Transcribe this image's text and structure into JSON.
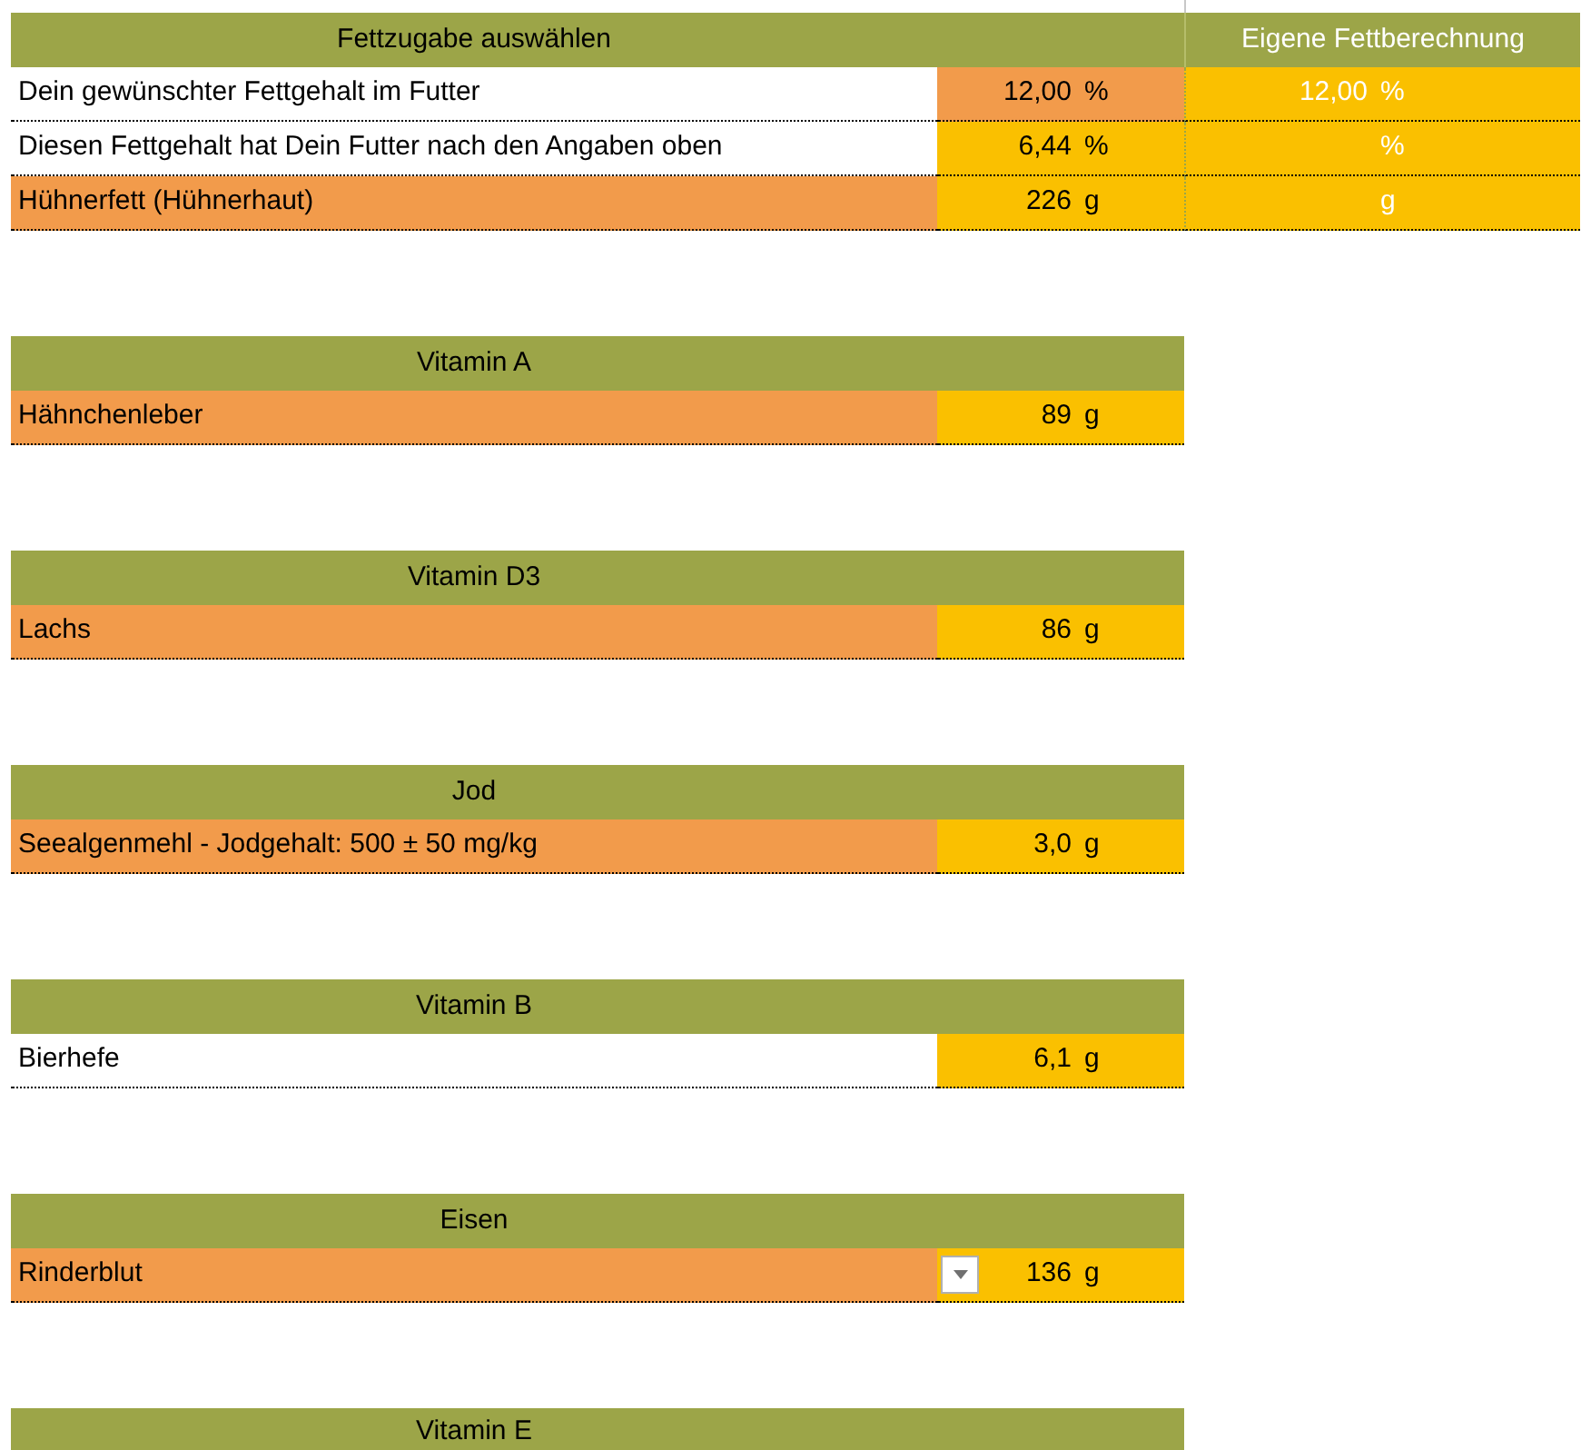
{
  "sections": [
    {
      "title": "Fettzugabe auswählen",
      "side_title": "Eigene Fettberechnung",
      "rows": [
        {
          "label": {
            "text": "Dein gewünschter Fettgehalt im Futter",
            "color": "#ffffff"
          },
          "value": {
            "text": "12,00",
            "unit": "%",
            "color": "#f29b4b"
          },
          "side": {
            "text": "12,00",
            "unit": "%"
          }
        },
        {
          "label": {
            "text": "Diesen Fettgehalt hat Dein Futter nach den Angaben oben",
            "color": "#ffffff"
          },
          "value": {
            "text": "6,44",
            "unit": "%",
            "color": "#fac000"
          },
          "side": {
            "unit": "%"
          }
        },
        {
          "label": {
            "text": "Hühnerfett (Hühnerhaut)",
            "color": "#f29b4b"
          },
          "value": {
            "text": "226",
            "unit": "g",
            "color": "#fac000"
          },
          "side": {
            "unit": "g"
          }
        }
      ]
    },
    {
      "title": "Vitamin A",
      "rows": [
        {
          "label": {
            "text": "Hähnchenleber",
            "color": "#f29b4b"
          },
          "value": {
            "text": "89",
            "unit": "g",
            "color": "#fac000"
          }
        }
      ]
    },
    {
      "title": "Vitamin D3",
      "rows": [
        {
          "label": {
            "text": "Lachs",
            "color": "#f29b4b"
          },
          "value": {
            "text": "86",
            "unit": "g",
            "color": "#fac000"
          }
        }
      ]
    },
    {
      "title": "Jod",
      "rows": [
        {
          "label": {
            "text": "Seealgenmehl - Jodgehalt: 500 ± 50 mg/kg",
            "color": "#f29b4b"
          },
          "value": {
            "text": "3,0",
            "unit": "g",
            "color": "#fac000"
          }
        }
      ]
    },
    {
      "title": "Vitamin B",
      "rows": [
        {
          "label": {
            "text": "Bierhefe",
            "color": "#ffffff"
          },
          "value": {
            "text": "6,1",
            "unit": "g",
            "color": "#fac000"
          }
        }
      ]
    },
    {
      "title": "Eisen",
      "rows": [
        {
          "label": {
            "text": "Rinderblut",
            "color": "#f29b4b"
          },
          "dropdown": true,
          "value": {
            "text": "136",
            "unit": "g",
            "color": "#fac000"
          }
        }
      ]
    },
    {
      "title": "Vitamin E"
    }
  ]
}
